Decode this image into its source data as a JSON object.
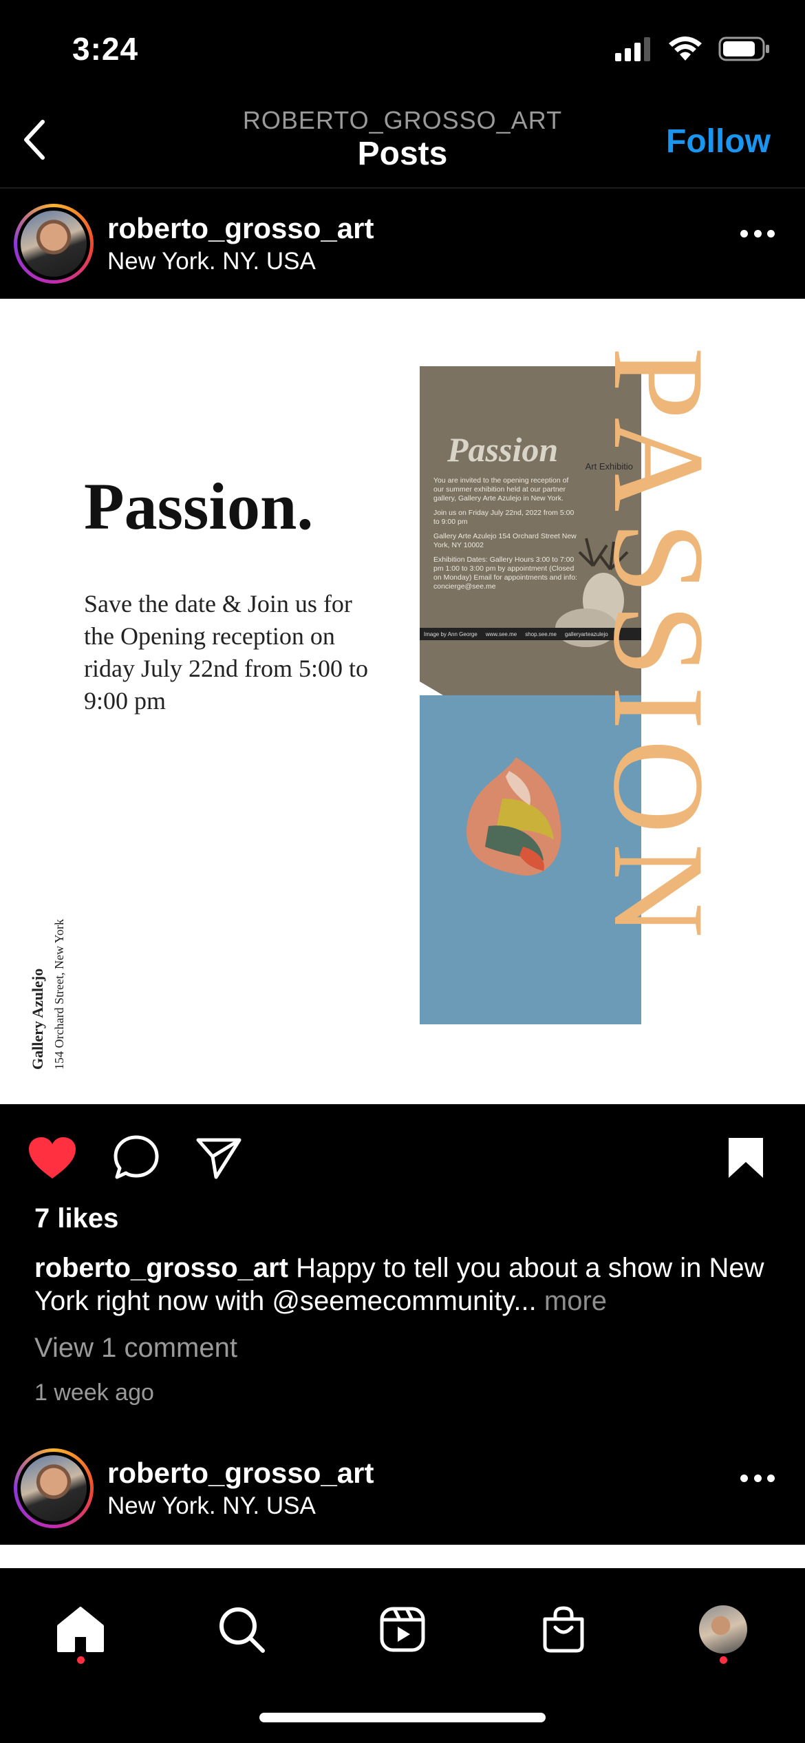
{
  "status_bar": {
    "time": "3:24"
  },
  "header": {
    "account": "ROBERTO_GROSSO_ART",
    "title": "Posts",
    "follow_label": "Follow"
  },
  "post": {
    "username": "roberto_grosso_art",
    "location": "New York. NY. USA",
    "image": {
      "title": "Passion.",
      "description": "Save the date & Join us for the Opening reception on riday July 22nd from 5:00 to 9:00 pm",
      "gallery_name": "Gallery Azulejo",
      "gallery_address": "154 Orchard Street, New York",
      "vertical_word": "PASSION",
      "poster": {
        "heading": "Passion",
        "subheading": "Art Exhibitio",
        "lines": [
          "You are invited to the opening reception of our summer exhibition held at our partner gallery, Gallery Arte Azulejo in New York.",
          "Join us on Friday July 22nd, 2022 from 5:00 to 9:00 pm",
          "Gallery Arte Azulejo 154 Orchard Street New York, NY 10002",
          "Exhibition Dates: Gallery Hours 3:00 to 7:00 pm 1:00 to 3:00 pm by appointment (Closed on Monday) Email for appointments and info: concierge@see.me"
        ],
        "footer": [
          "Image by Ann George",
          "www.see.me",
          "shop.see.me",
          "galleryarteazulejo"
        ]
      }
    },
    "likes": "7 likes",
    "caption_user": "roberto_grosso_art",
    "caption_text": "Happy to tell you about a show in New York right now with @seemecommunity...",
    "caption_more": "more",
    "view_comments": "View 1 comment",
    "time_ago": "1 week ago",
    "liked": true,
    "saved": true
  },
  "next_post": {
    "username": "roberto_grosso_art",
    "location": "New York. NY. USA"
  },
  "tab_bar": {
    "items": [
      "home-icon",
      "search-icon",
      "reels-icon",
      "shop-icon",
      "profile-avatar"
    ],
    "notification_color": "#ff3040"
  },
  "colors": {
    "accent": "#1a95f0",
    "like": "#ff3040",
    "passion_orange": "#eeb779",
    "poster_blue": "#6b9bb6"
  }
}
